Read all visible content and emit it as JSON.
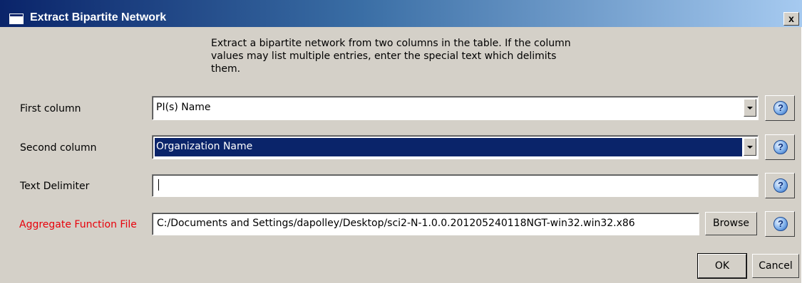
{
  "window": {
    "title": "Extract Bipartite Network",
    "close_label": "x"
  },
  "description": "Extract a bipartite network from two columns in the table.  If the column\nvalues may list multiple entries, enter the special text which delimits\nthem.",
  "fields": {
    "first_column": {
      "label": "First column",
      "value": "PI(s) Name"
    },
    "second_column": {
      "label": "Second column",
      "value": "Organization Name"
    },
    "text_delimiter": {
      "label": "Text Delimiter",
      "value": ""
    },
    "aggregate_function_file": {
      "label": "Aggregate Function File",
      "value": "C:/Documents and Settings/dapolley/Desktop/sci2-N-1.0.0.201205240118NGT-win32.win32.x86"
    }
  },
  "buttons": {
    "browse": "Browse",
    "ok": "OK",
    "cancel": "Cancel",
    "help_glyph": "?"
  },
  "colors": {
    "title_bar_start": "#0a246a",
    "title_bar_end": "#a6caf0",
    "dialog_background": "#d4d0c8",
    "selection": "#0a246a",
    "required_label": "#e8000a"
  }
}
